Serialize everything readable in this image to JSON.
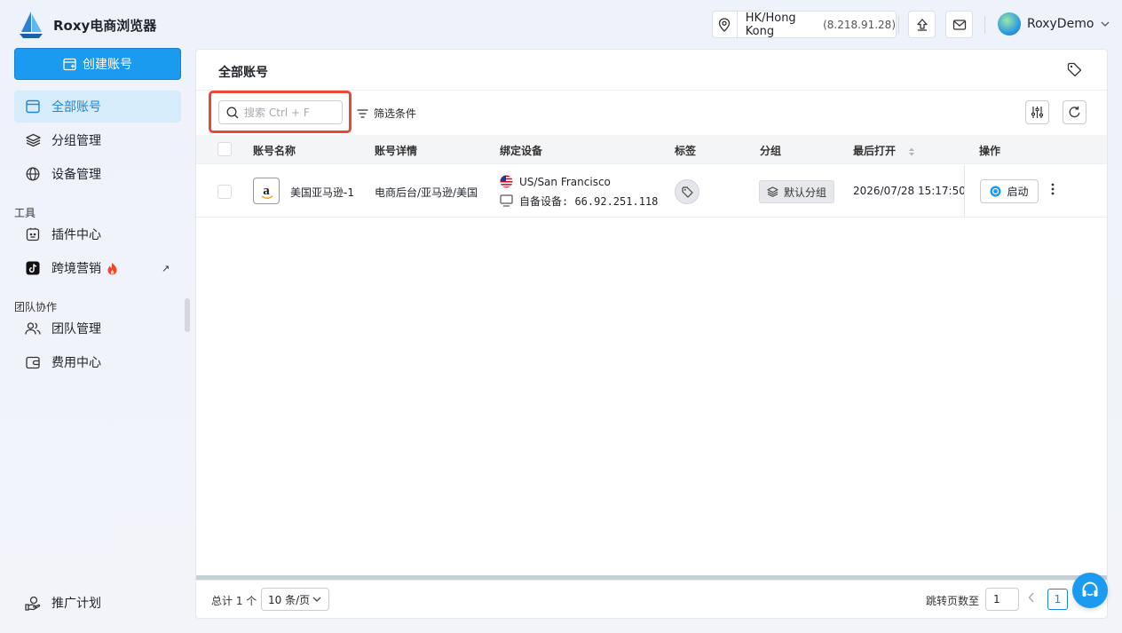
{
  "app": {
    "title": "Roxy电商浏览器"
  },
  "header": {
    "location": "HK/Hong Kong",
    "ip": "(8.218.91.28)",
    "user_name": "RoxyDemo"
  },
  "sidebar": {
    "create_label": "创建账号",
    "items": [
      {
        "label": "全部账号",
        "icon": "window-icon",
        "active": true
      },
      {
        "label": "分组管理",
        "icon": "layers-icon"
      },
      {
        "label": "设备管理",
        "icon": "globe-icon"
      }
    ],
    "tools_label": "工具",
    "tools": [
      {
        "label": "插件中心",
        "icon": "plugin-icon"
      },
      {
        "label": "跨境营销",
        "icon": "tiktok-icon",
        "badge": "fire-icon",
        "external": "↗"
      }
    ],
    "team_label": "团队协作",
    "team": [
      {
        "label": "团队管理",
        "icon": "users-icon"
      },
      {
        "label": "费用中心",
        "icon": "wallet-icon"
      }
    ],
    "bottom": {
      "label": "推广计划",
      "icon": "promote-icon"
    }
  },
  "main": {
    "title": "全部账号",
    "search_placeholder": "搜索 Ctrl + F",
    "filter_label": "筛选条件",
    "columns": [
      "账号名称",
      "账号详情",
      "绑定设备",
      "标签",
      "分组",
      "最后打开",
      "操作"
    ],
    "rows": [
      {
        "platform_logo": "a",
        "name": "美国亚马逊-1",
        "detail": "电商后台/亚马逊/美国",
        "device_location": "US/San Francisco",
        "device_info": "自备设备: 66.92.251.118",
        "group": "默认分组",
        "last_open": "2026/07/28 15:17:50",
        "action": "启动"
      }
    ],
    "footer": {
      "total": "总计 1 个",
      "page_size": "10 条/页",
      "jump_label": "跳转页数至",
      "jump_value": "1",
      "current_page": "1"
    }
  },
  "colors": {
    "accent": "#1a9bf0",
    "active_bg": "#d6ecfb",
    "highlight": "#e8483a"
  }
}
